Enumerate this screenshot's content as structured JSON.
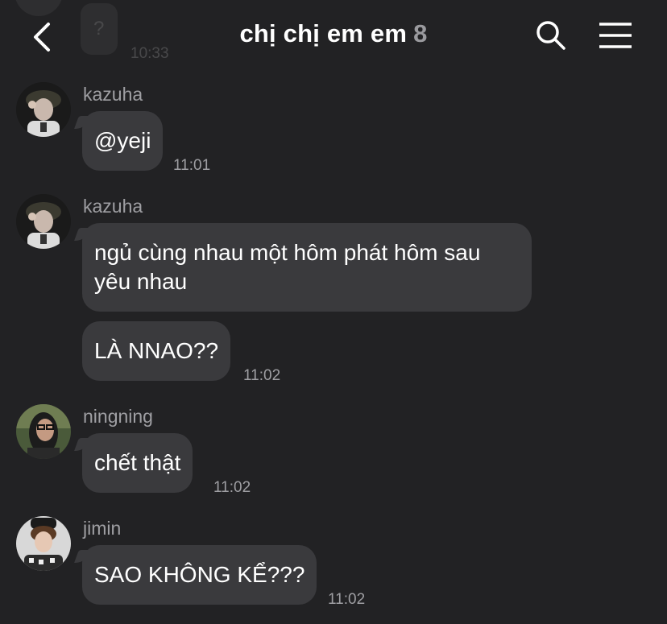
{
  "header": {
    "title": "chị chị em em",
    "member_count": "8",
    "back_icon": "chevron-left-icon",
    "search_icon": "search-icon",
    "menu_icon": "hamburger-menu-icon"
  },
  "previous_message": {
    "text": "?",
    "time": "10:33"
  },
  "messages": [
    {
      "sender": "kazuha",
      "text": "@yeji",
      "time": "11:01"
    },
    {
      "sender": "kazuha",
      "text": "ngủ cùng nhau một hôm phát hôm sau yêu nhau"
    },
    {
      "text": "LÀ NNAO??",
      "time": "11:02"
    },
    {
      "sender": "ningning",
      "text": "chết thật",
      "time": "11:02"
    },
    {
      "sender": "jimin",
      "text": "SAO KHÔNG KỂ???",
      "time": "11:02"
    }
  ],
  "colors": {
    "background": "#222224",
    "bubble": "#3a3a3d",
    "meta_text": "#9f9fa3"
  }
}
